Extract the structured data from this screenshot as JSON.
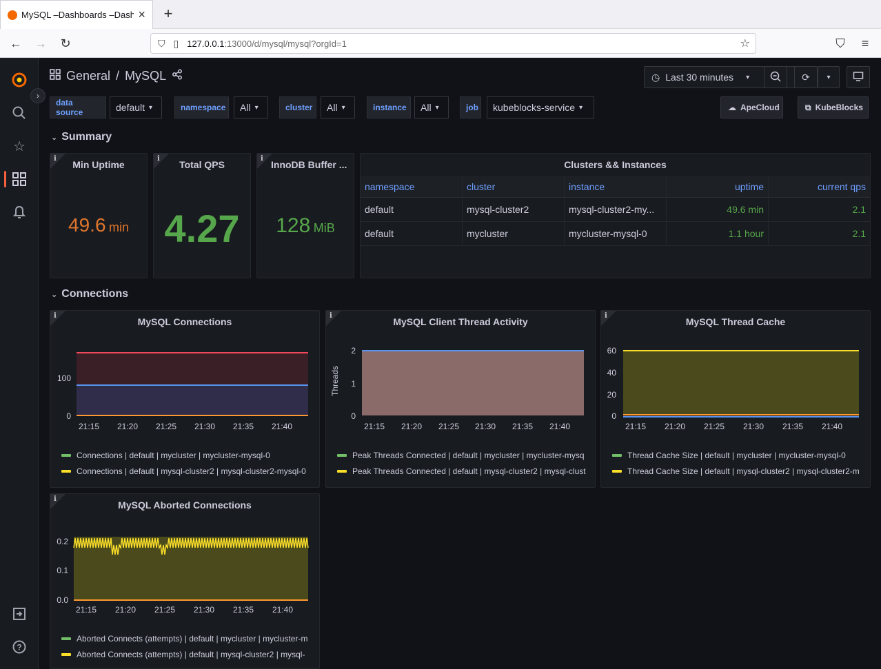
{
  "browser": {
    "tab_title": "MySQL –Dashboards –Dashb",
    "url_host": "127.0.0.1",
    "url_rest": ":13000/d/mysql/mysql?orgId=1"
  },
  "topbar": {
    "breadcrumb_root": "General",
    "breadcrumb_sep": "/",
    "breadcrumb_page": "MySQL",
    "time_range": "Last 30 minutes"
  },
  "variables": [
    {
      "label": "data source",
      "value": "default"
    },
    {
      "label": "namespace",
      "value": "All"
    },
    {
      "label": "cluster",
      "value": "All"
    },
    {
      "label": "instance",
      "value": "All"
    },
    {
      "label": "job",
      "value": "kubeblocks-service"
    }
  ],
  "links": {
    "apecloud": "ApeCloud",
    "kubeblocks": "KubeBlocks"
  },
  "rows": {
    "summary": "Summary",
    "connections": "Connections"
  },
  "stats": {
    "min_uptime": {
      "title": "Min Uptime",
      "value": "49.6",
      "unit": "min",
      "color": "#e0752d"
    },
    "total_qps": {
      "title": "Total QPS",
      "value": "4.27",
      "unit": "",
      "color": "#56a64b"
    },
    "innodb": {
      "title": "InnoDB Buffer ...",
      "value": "128",
      "unit": "MiB",
      "color": "#56a64b"
    }
  },
  "table": {
    "title": "Clusters && Instances",
    "headers": [
      "namespace",
      "cluster",
      "instance",
      "uptime",
      "current qps"
    ],
    "rows": [
      [
        "default",
        "mysql-cluster2",
        "mysql-cluster2-my...",
        "49.6 min",
        "2.1"
      ],
      [
        "default",
        "mycluster",
        "mycluster-mysql-0",
        "1.1 hour",
        "2.1"
      ]
    ]
  },
  "charts": {
    "connections": {
      "title": "MySQL Connections",
      "legend": [
        "Connections | default | mycluster | mycluster-mysql-0",
        "Connections | default | mysql-cluster2 | mysql-cluster2-mysql-0"
      ]
    },
    "client_threads": {
      "title": "MySQL Client Thread Activity",
      "ylabel": "Threads",
      "legend": [
        "Peak Threads Connected | default | mycluster | mycluster-mysq",
        "Peak Threads Connected | default | mysql-cluster2 | mysql-clust"
      ]
    },
    "thread_cache": {
      "title": "MySQL Thread Cache",
      "legend": [
        "Thread Cache Size | default | mycluster | mycluster-mysql-0",
        "Thread Cache Size | default | mysql-cluster2 | mysql-cluster2-m"
      ]
    },
    "aborted": {
      "title": "MySQL Aborted Connections",
      "legend": [
        "Aborted Connects (attempts) | default | mycluster | mycluster-m",
        "Aborted Connects (attempts) | default | mysql-cluster2 | mysql-"
      ]
    },
    "x_ticks": [
      "21:15",
      "21:20",
      "21:25",
      "21:30",
      "21:35",
      "21:40"
    ]
  },
  "colors": {
    "green": "#73bf69",
    "yellow": "#fade2a",
    "blue": "#5794f2",
    "red": "#f2495c",
    "orange": "#ff9830"
  },
  "chart_data": [
    {
      "type": "line",
      "title": "MySQL Connections",
      "x": [
        "21:15",
        "21:20",
        "21:25",
        "21:30",
        "21:35",
        "21:40"
      ],
      "ylim": [
        0,
        180
      ],
      "yticks": [
        0,
        100
      ],
      "series": [
        {
          "name": "Connections | default | mycluster | mycluster-mysql-0",
          "values": [
            0,
            0,
            0,
            0,
            0,
            0
          ]
        },
        {
          "name": "Connections | default | mysql-cluster2 | mysql-cluster2-mysql-0",
          "values": [
            0,
            0,
            0,
            0,
            0,
            0
          ]
        }
      ]
    },
    {
      "type": "area",
      "title": "MySQL Client Thread Activity",
      "ylabel": "Threads",
      "x": [
        "21:15",
        "21:20",
        "21:25",
        "21:30",
        "21:35",
        "21:40"
      ],
      "ylim": [
        0,
        2
      ],
      "yticks": [
        0,
        1,
        2
      ],
      "series": [
        {
          "name": "Peak Threads Connected | default | mycluster | mycluster-mysq",
          "values": [
            2,
            2,
            2,
            2,
            2,
            2
          ]
        },
        {
          "name": "Peak Threads Connected | default | mysql-cluster2 | mysql-clust",
          "values": [
            2,
            2,
            2,
            2,
            2,
            2
          ]
        }
      ]
    },
    {
      "type": "area",
      "title": "MySQL Thread Cache",
      "x": [
        "21:15",
        "21:20",
        "21:25",
        "21:30",
        "21:35",
        "21:40"
      ],
      "ylim": [
        0,
        60
      ],
      "yticks": [
        0,
        20,
        40,
        60
      ],
      "series": [
        {
          "name": "Thread Cache Size | default | mycluster | mycluster-mysql-0",
          "values": [
            60,
            60,
            60,
            60,
            60,
            60
          ]
        },
        {
          "name": "Thread Cache Size | default | mysql-cluster2 | mysql-cluster2-m",
          "values": [
            60,
            60,
            60,
            60,
            60,
            60
          ]
        }
      ]
    },
    {
      "type": "area",
      "title": "MySQL Aborted Connections",
      "x": [
        "21:15",
        "21:20",
        "21:25",
        "21:30",
        "21:35",
        "21:40"
      ],
      "ylim": [
        0,
        0.22
      ],
      "yticks": [
        0.0,
        0.1,
        0.2
      ],
      "series": [
        {
          "name": "Aborted Connects (attempts) | default | mycluster | mycluster-m",
          "values": [
            0.2,
            0.2,
            0.2,
            0.2,
            0.2,
            0.2
          ]
        },
        {
          "name": "Aborted Connects (attempts) | default | mysql-cluster2 | mysql-",
          "values": [
            0.2,
            0.2,
            0.2,
            0.2,
            0.2,
            0.2
          ]
        }
      ]
    }
  ]
}
